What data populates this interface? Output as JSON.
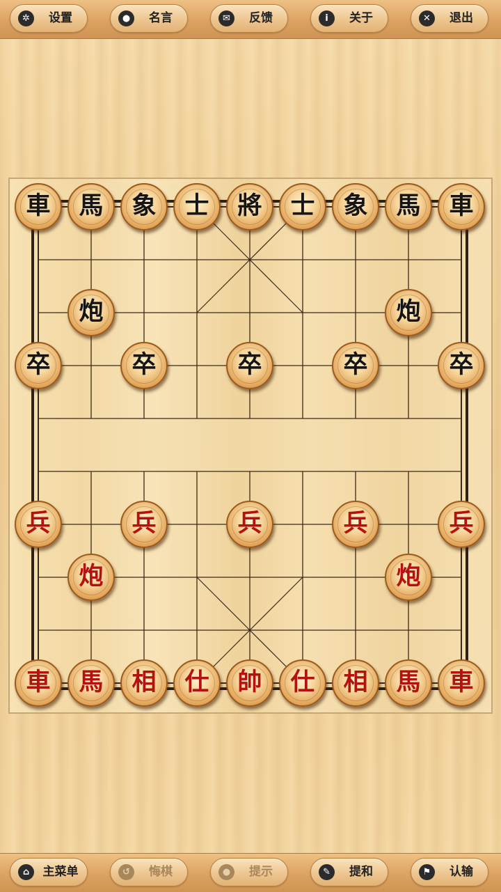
{
  "top_bar": {
    "buttons": [
      {
        "name": "settings-button",
        "icon": "gear-icon",
        "glyph": "✲",
        "label": "设置"
      },
      {
        "name": "quotes-button",
        "icon": "speech-bubble-icon",
        "glyph": "●",
        "label": "名言"
      },
      {
        "name": "feedback-button",
        "icon": "envelope-icon",
        "glyph": "✉",
        "label": "反馈"
      },
      {
        "name": "about-button",
        "icon": "info-icon",
        "glyph": "i",
        "label": "关于"
      },
      {
        "name": "exit-button",
        "icon": "close-icon",
        "glyph": "✕",
        "label": "退出"
      }
    ]
  },
  "bottom_bar": {
    "buttons": [
      {
        "name": "main-menu-button",
        "icon": "home-icon",
        "glyph": "⌂",
        "label": "主菜单",
        "enabled": true
      },
      {
        "name": "undo-button",
        "icon": "undo-icon",
        "glyph": "↺",
        "label": "悔棋",
        "enabled": false
      },
      {
        "name": "hint-button",
        "icon": "lightbulb-icon",
        "glyph": "●",
        "label": "提示",
        "enabled": false
      },
      {
        "name": "offer-draw-button",
        "icon": "pencil-icon",
        "glyph": "✎",
        "label": "提和",
        "enabled": true
      },
      {
        "name": "resign-button",
        "icon": "flag-icon",
        "glyph": "⚑",
        "label": "认输",
        "enabled": true
      }
    ]
  },
  "board": {
    "columns": 9,
    "rows": 10,
    "pieces": [
      {
        "text": "車",
        "side": "black",
        "col": 0,
        "row": 0
      },
      {
        "text": "馬",
        "side": "black",
        "col": 1,
        "row": 0
      },
      {
        "text": "象",
        "side": "black",
        "col": 2,
        "row": 0
      },
      {
        "text": "士",
        "side": "black",
        "col": 3,
        "row": 0
      },
      {
        "text": "將",
        "side": "black",
        "col": 4,
        "row": 0
      },
      {
        "text": "士",
        "side": "black",
        "col": 5,
        "row": 0
      },
      {
        "text": "象",
        "side": "black",
        "col": 6,
        "row": 0
      },
      {
        "text": "馬",
        "side": "black",
        "col": 7,
        "row": 0
      },
      {
        "text": "車",
        "side": "black",
        "col": 8,
        "row": 0
      },
      {
        "text": "炮",
        "side": "black",
        "col": 1,
        "row": 2
      },
      {
        "text": "炮",
        "side": "black",
        "col": 7,
        "row": 2
      },
      {
        "text": "卒",
        "side": "black",
        "col": 0,
        "row": 3
      },
      {
        "text": "卒",
        "side": "black",
        "col": 2,
        "row": 3
      },
      {
        "text": "卒",
        "side": "black",
        "col": 4,
        "row": 3
      },
      {
        "text": "卒",
        "side": "black",
        "col": 6,
        "row": 3
      },
      {
        "text": "卒",
        "side": "black",
        "col": 8,
        "row": 3
      },
      {
        "text": "兵",
        "side": "red",
        "col": 0,
        "row": 6
      },
      {
        "text": "兵",
        "side": "red",
        "col": 2,
        "row": 6
      },
      {
        "text": "兵",
        "side": "red",
        "col": 4,
        "row": 6
      },
      {
        "text": "兵",
        "side": "red",
        "col": 6,
        "row": 6
      },
      {
        "text": "兵",
        "side": "red",
        "col": 8,
        "row": 6
      },
      {
        "text": "炮",
        "side": "red",
        "col": 1,
        "row": 7
      },
      {
        "text": "炮",
        "side": "red",
        "col": 7,
        "row": 7
      },
      {
        "text": "車",
        "side": "red",
        "col": 0,
        "row": 9
      },
      {
        "text": "馬",
        "side": "red",
        "col": 1,
        "row": 9
      },
      {
        "text": "相",
        "side": "red",
        "col": 2,
        "row": 9
      },
      {
        "text": "仕",
        "side": "red",
        "col": 3,
        "row": 9
      },
      {
        "text": "帥",
        "side": "red",
        "col": 4,
        "row": 9
      },
      {
        "text": "仕",
        "side": "red",
        "col": 5,
        "row": 9
      },
      {
        "text": "相",
        "side": "red",
        "col": 6,
        "row": 9
      },
      {
        "text": "馬",
        "side": "red",
        "col": 7,
        "row": 9
      },
      {
        "text": "車",
        "side": "red",
        "col": 8,
        "row": 9
      }
    ]
  },
  "colors": {
    "black_piece_text": "#151515",
    "red_piece_text": "#b3120f",
    "grid_line": "#3a2a18"
  }
}
